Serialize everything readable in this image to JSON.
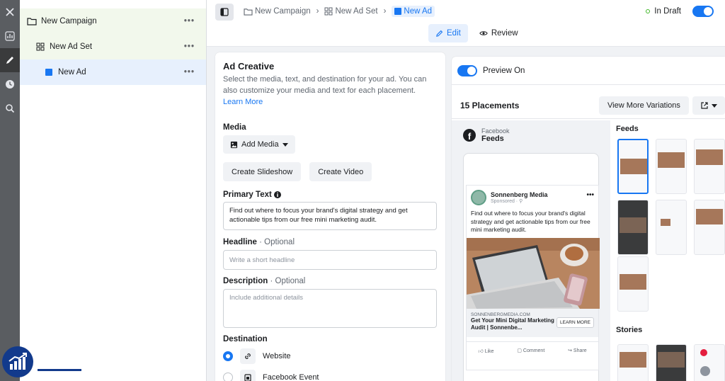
{
  "tree": {
    "campaign": "New Campaign",
    "adset": "New Ad Set",
    "ad": "New Ad",
    "more": "•••"
  },
  "breadcrumb": {
    "campaign": "New Campaign",
    "adset": "New Ad Set",
    "ad": "New Ad",
    "sep": "›"
  },
  "status": {
    "label": "In Draft"
  },
  "modes": {
    "edit": "Edit",
    "review": "Review"
  },
  "creative": {
    "title": "Ad Creative",
    "description": "Select the media, text, and destination for your ad. You can also customize your media and text for each placement.",
    "learn_more": "Learn More",
    "media_label": "Media",
    "add_media": "Add Media",
    "create_slideshow": "Create Slideshow",
    "create_video": "Create Video",
    "primary_text_label": "Primary Text",
    "primary_text_value": "Find out where to focus your brand's digital strategy and get actionable tips from our free mini marketing audit.",
    "headline_label": "Headline",
    "headline_optional": "· Optional",
    "headline_placeholder": "Write a short headline",
    "description_label": "Description",
    "description_optional": "· Optional",
    "description_placeholder": "Include additional details",
    "destination_label": "Destination",
    "destinations": [
      {
        "label": "Website",
        "selected": true
      },
      {
        "label": "Facebook Event",
        "selected": false
      }
    ]
  },
  "preview": {
    "toggle_label": "Preview On",
    "placements_title": "15 Placements",
    "view_more": "View More Variations",
    "feed_platform": "Facebook",
    "feed_type": "Feeds",
    "feeds_label": "Feeds",
    "stories_label": "Stories",
    "post": {
      "page_name": "Sonnenberg Media",
      "sponsored": "Sponsored · ⚲",
      "text": "Find out where to focus your brand's digital strategy and get actionable tips from our free mini marketing audit.",
      "url": "SONNENBERGMEDIA.COM",
      "headline": "Get Your Mini Digital Marketing Audit | Sonnenbe...",
      "cta": "LEARN MORE",
      "like": "Like",
      "comment": "Comment",
      "share": "Share"
    }
  },
  "colors": {
    "accent": "#1877f2",
    "draft_dot": "#42b72a",
    "logo": "#123a8c"
  }
}
